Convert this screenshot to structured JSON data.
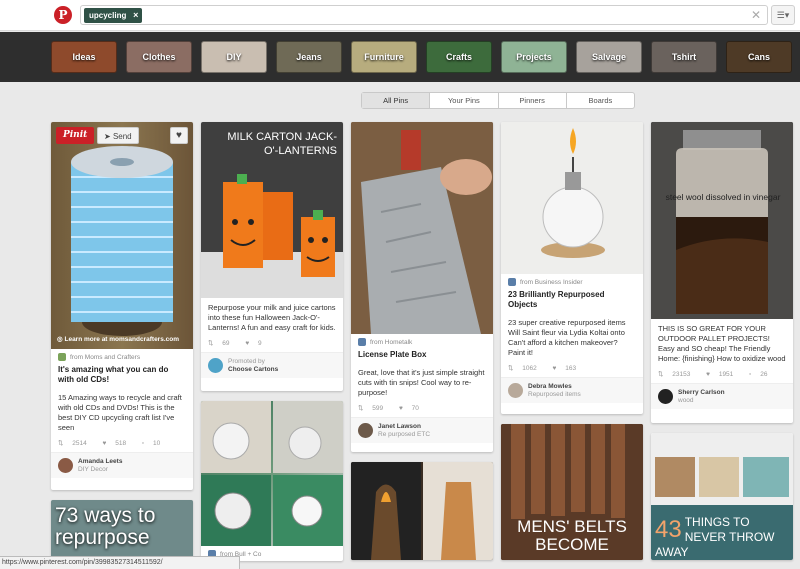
{
  "header": {
    "search_tag": "upcycling",
    "tag_remove": "×",
    "clear": "✕",
    "menu": "☰▾",
    "logo": "P"
  },
  "categories": [
    {
      "label": "Ideas",
      "color": "#8e4a2c"
    },
    {
      "label": "Clothes",
      "color": "#8b6d63"
    },
    {
      "label": "DIY",
      "color": "#c9beb1"
    },
    {
      "label": "Jeans",
      "color": "#6f6a56"
    },
    {
      "label": "Furniture",
      "color": "#b7ac7e"
    },
    {
      "label": "Crafts",
      "color": "#3d6b3c"
    },
    {
      "label": "Projects",
      "color": "#8fb395"
    },
    {
      "label": "Salvage",
      "color": "#a7a29c"
    },
    {
      "label": "Tshirt",
      "color": "#6a625d"
    },
    {
      "label": "Cans",
      "color": "#4e3a26"
    }
  ],
  "filters": [
    "All Pins",
    "Your Pins",
    "Pinners",
    "Boards"
  ],
  "pins": {
    "cd_lamp": {
      "pin_it": "Pinit",
      "send": "Send",
      "learn_more": "Learn more at momsandcrafters.com",
      "source": "from Moms and Crafters",
      "title": "It's amazing what you can do with old CDs!",
      "desc": "15 Amazing ways to recycle and craft with old CDs and DVDs! This is the best DIY CD upcycling craft list I've seen",
      "repins": "2514",
      "likes": "518",
      "comments": "10",
      "owner_name": "Amanda Leets",
      "owner_board": "DIY Decor"
    },
    "ways": {
      "overlay": "73 ways to repurpose"
    },
    "milk": {
      "overlay": "MILK CARTON JACK-O'-LANTERNS",
      "desc": "Repurpose your milk and juice cartons into these fun Halloween Jack-O'-Lanterns! A fun and easy craft for kids.",
      "repins": "69",
      "likes": "9",
      "promoted": "Promoted by",
      "promoter": "Choose Cartons"
    },
    "bulbs": {
      "source": "from Bull + Co"
    },
    "plate": {
      "source": "from Hometalk",
      "title": "License Plate Box",
      "desc": "Great, love that it's just simple straight cuts with tin snips! Cool way to re-purpose!",
      "repins": "599",
      "likes": "70",
      "owner_name": "Janet Lawson",
      "owner_board": "Re purposed ETC"
    },
    "oil": {
      "source": "from Business Insider",
      "title": "23 Brilliantly Repurposed Objects",
      "desc": "23 super creative repurposed items Will Saint fleur via Lydia Koltai onto Can't afford a kitchen makeover? Paint it!",
      "repins": "1062",
      "likes": "163",
      "owner_name": "Debra Mowles",
      "owner_board": "Repurposed items"
    },
    "belts": {
      "overlay": "MENS' BELTS BECOME"
    },
    "jar": {
      "overlay": "steel wool dissolved in vinegar",
      "desc": "THIS IS SO GREAT FOR YOUR OUTDOOR PALLET PROJECTS! Easy and SO cheap! The Friendly Home: {finishing} How to oxidize wood",
      "repins": "23153",
      "likes": "1951",
      "comments": "26",
      "owner_name": "Sherry Carlson",
      "owner_board": "wood"
    },
    "things": {
      "overlay_num": "43",
      "overlay": "THINGS TO NEVER THROW AWAY"
    }
  },
  "status_url": "https://www.pinterest.com/pin/39983527314511592/"
}
